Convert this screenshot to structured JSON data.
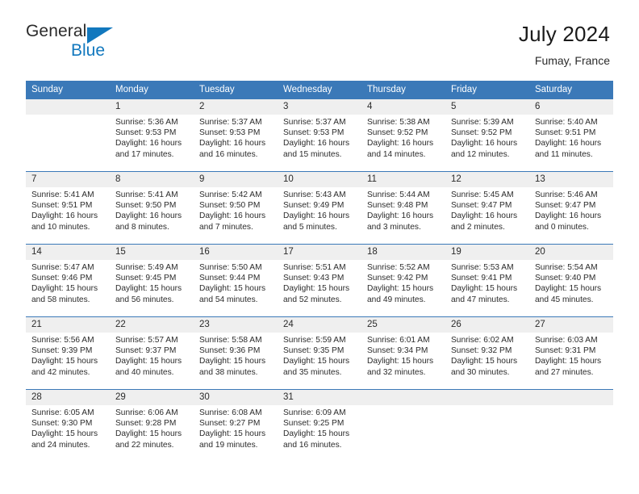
{
  "brand": {
    "name_part1": "General",
    "name_part2": "Blue",
    "triangle_color": "#1278be"
  },
  "header": {
    "title": "July 2024",
    "location": "Fumay, France"
  },
  "theme": {
    "header_blue": "#3b79b8",
    "daynum_gray": "#efefef"
  },
  "columns": [
    "Sunday",
    "Monday",
    "Tuesday",
    "Wednesday",
    "Thursday",
    "Friday",
    "Saturday"
  ],
  "weeks": [
    [
      {
        "day": "",
        "blank": true
      },
      {
        "day": "1",
        "sunrise": "Sunrise: 5:36 AM",
        "sunset": "Sunset: 9:53 PM",
        "daylight_l1": "Daylight: 16 hours",
        "daylight_l2": "and 17 minutes."
      },
      {
        "day": "2",
        "sunrise": "Sunrise: 5:37 AM",
        "sunset": "Sunset: 9:53 PM",
        "daylight_l1": "Daylight: 16 hours",
        "daylight_l2": "and 16 minutes."
      },
      {
        "day": "3",
        "sunrise": "Sunrise: 5:37 AM",
        "sunset": "Sunset: 9:53 PM",
        "daylight_l1": "Daylight: 16 hours",
        "daylight_l2": "and 15 minutes."
      },
      {
        "day": "4",
        "sunrise": "Sunrise: 5:38 AM",
        "sunset": "Sunset: 9:52 PM",
        "daylight_l1": "Daylight: 16 hours",
        "daylight_l2": "and 14 minutes."
      },
      {
        "day": "5",
        "sunrise": "Sunrise: 5:39 AM",
        "sunset": "Sunset: 9:52 PM",
        "daylight_l1": "Daylight: 16 hours",
        "daylight_l2": "and 12 minutes."
      },
      {
        "day": "6",
        "sunrise": "Sunrise: 5:40 AM",
        "sunset": "Sunset: 9:51 PM",
        "daylight_l1": "Daylight: 16 hours",
        "daylight_l2": "and 11 minutes."
      }
    ],
    [
      {
        "day": "7",
        "sunrise": "Sunrise: 5:41 AM",
        "sunset": "Sunset: 9:51 PM",
        "daylight_l1": "Daylight: 16 hours",
        "daylight_l2": "and 10 minutes."
      },
      {
        "day": "8",
        "sunrise": "Sunrise: 5:41 AM",
        "sunset": "Sunset: 9:50 PM",
        "daylight_l1": "Daylight: 16 hours",
        "daylight_l2": "and 8 minutes."
      },
      {
        "day": "9",
        "sunrise": "Sunrise: 5:42 AM",
        "sunset": "Sunset: 9:50 PM",
        "daylight_l1": "Daylight: 16 hours",
        "daylight_l2": "and 7 minutes."
      },
      {
        "day": "10",
        "sunrise": "Sunrise: 5:43 AM",
        "sunset": "Sunset: 9:49 PM",
        "daylight_l1": "Daylight: 16 hours",
        "daylight_l2": "and 5 minutes."
      },
      {
        "day": "11",
        "sunrise": "Sunrise: 5:44 AM",
        "sunset": "Sunset: 9:48 PM",
        "daylight_l1": "Daylight: 16 hours",
        "daylight_l2": "and 3 minutes."
      },
      {
        "day": "12",
        "sunrise": "Sunrise: 5:45 AM",
        "sunset": "Sunset: 9:47 PM",
        "daylight_l1": "Daylight: 16 hours",
        "daylight_l2": "and 2 minutes."
      },
      {
        "day": "13",
        "sunrise": "Sunrise: 5:46 AM",
        "sunset": "Sunset: 9:47 PM",
        "daylight_l1": "Daylight: 16 hours",
        "daylight_l2": "and 0 minutes."
      }
    ],
    [
      {
        "day": "14",
        "sunrise": "Sunrise: 5:47 AM",
        "sunset": "Sunset: 9:46 PM",
        "daylight_l1": "Daylight: 15 hours",
        "daylight_l2": "and 58 minutes."
      },
      {
        "day": "15",
        "sunrise": "Sunrise: 5:49 AM",
        "sunset": "Sunset: 9:45 PM",
        "daylight_l1": "Daylight: 15 hours",
        "daylight_l2": "and 56 minutes."
      },
      {
        "day": "16",
        "sunrise": "Sunrise: 5:50 AM",
        "sunset": "Sunset: 9:44 PM",
        "daylight_l1": "Daylight: 15 hours",
        "daylight_l2": "and 54 minutes."
      },
      {
        "day": "17",
        "sunrise": "Sunrise: 5:51 AM",
        "sunset": "Sunset: 9:43 PM",
        "daylight_l1": "Daylight: 15 hours",
        "daylight_l2": "and 52 minutes."
      },
      {
        "day": "18",
        "sunrise": "Sunrise: 5:52 AM",
        "sunset": "Sunset: 9:42 PM",
        "daylight_l1": "Daylight: 15 hours",
        "daylight_l2": "and 49 minutes."
      },
      {
        "day": "19",
        "sunrise": "Sunrise: 5:53 AM",
        "sunset": "Sunset: 9:41 PM",
        "daylight_l1": "Daylight: 15 hours",
        "daylight_l2": "and 47 minutes."
      },
      {
        "day": "20",
        "sunrise": "Sunrise: 5:54 AM",
        "sunset": "Sunset: 9:40 PM",
        "daylight_l1": "Daylight: 15 hours",
        "daylight_l2": "and 45 minutes."
      }
    ],
    [
      {
        "day": "21",
        "sunrise": "Sunrise: 5:56 AM",
        "sunset": "Sunset: 9:39 PM",
        "daylight_l1": "Daylight: 15 hours",
        "daylight_l2": "and 42 minutes."
      },
      {
        "day": "22",
        "sunrise": "Sunrise: 5:57 AM",
        "sunset": "Sunset: 9:37 PM",
        "daylight_l1": "Daylight: 15 hours",
        "daylight_l2": "and 40 minutes."
      },
      {
        "day": "23",
        "sunrise": "Sunrise: 5:58 AM",
        "sunset": "Sunset: 9:36 PM",
        "daylight_l1": "Daylight: 15 hours",
        "daylight_l2": "and 38 minutes."
      },
      {
        "day": "24",
        "sunrise": "Sunrise: 5:59 AM",
        "sunset": "Sunset: 9:35 PM",
        "daylight_l1": "Daylight: 15 hours",
        "daylight_l2": "and 35 minutes."
      },
      {
        "day": "25",
        "sunrise": "Sunrise: 6:01 AM",
        "sunset": "Sunset: 9:34 PM",
        "daylight_l1": "Daylight: 15 hours",
        "daylight_l2": "and 32 minutes."
      },
      {
        "day": "26",
        "sunrise": "Sunrise: 6:02 AM",
        "sunset": "Sunset: 9:32 PM",
        "daylight_l1": "Daylight: 15 hours",
        "daylight_l2": "and 30 minutes."
      },
      {
        "day": "27",
        "sunrise": "Sunrise: 6:03 AM",
        "sunset": "Sunset: 9:31 PM",
        "daylight_l1": "Daylight: 15 hours",
        "daylight_l2": "and 27 minutes."
      }
    ],
    [
      {
        "day": "28",
        "sunrise": "Sunrise: 6:05 AM",
        "sunset": "Sunset: 9:30 PM",
        "daylight_l1": "Daylight: 15 hours",
        "daylight_l2": "and 24 minutes."
      },
      {
        "day": "29",
        "sunrise": "Sunrise: 6:06 AM",
        "sunset": "Sunset: 9:28 PM",
        "daylight_l1": "Daylight: 15 hours",
        "daylight_l2": "and 22 minutes."
      },
      {
        "day": "30",
        "sunrise": "Sunrise: 6:08 AM",
        "sunset": "Sunset: 9:27 PM",
        "daylight_l1": "Daylight: 15 hours",
        "daylight_l2": "and 19 minutes."
      },
      {
        "day": "31",
        "sunrise": "Sunrise: 6:09 AM",
        "sunset": "Sunset: 9:25 PM",
        "daylight_l1": "Daylight: 15 hours",
        "daylight_l2": "and 16 minutes."
      },
      {
        "day": "",
        "blank": true
      },
      {
        "day": "",
        "blank": true
      },
      {
        "day": "",
        "blank": true
      }
    ]
  ]
}
